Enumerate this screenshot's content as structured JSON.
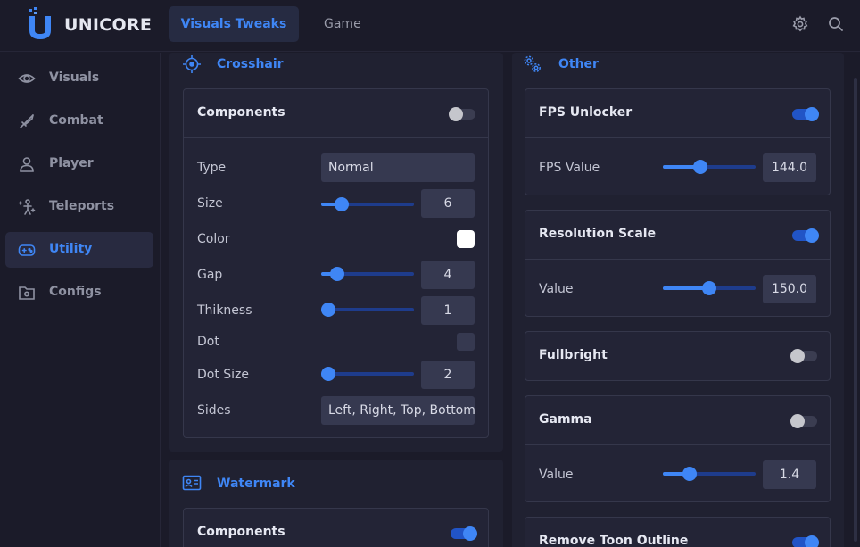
{
  "app": {
    "brand": "UNICORE"
  },
  "tabs": [
    {
      "label": "Visuals Tweaks"
    },
    {
      "label": "Game"
    }
  ],
  "sidebar": {
    "items": [
      {
        "label": "Visuals",
        "icon": "eye-icon"
      },
      {
        "label": "Combat",
        "icon": "sword-icon"
      },
      {
        "label": "Player",
        "icon": "user-icon"
      },
      {
        "label": "Teleports",
        "icon": "teleport-icon"
      },
      {
        "label": "Utility",
        "icon": "gamepad-icon"
      },
      {
        "label": "Configs",
        "icon": "folder-gear-icon"
      }
    ],
    "active": "Utility"
  },
  "crosshair": {
    "title": "Crosshair",
    "card_title": "Components",
    "enabled": false,
    "type": {
      "label": "Type",
      "value": "Normal"
    },
    "size": {
      "label": "Size",
      "value": "6",
      "fraction": 0.22
    },
    "color": {
      "label": "Color",
      "value": "#ffffff"
    },
    "gap": {
      "label": "Gap",
      "value": "4",
      "fraction": 0.17
    },
    "thikness": {
      "label": "Thikness",
      "value": "1",
      "fraction": 0.08
    },
    "dot": {
      "label": "Dot",
      "checked": false
    },
    "dot_size": {
      "label": "Dot Size",
      "value": "2",
      "fraction": 0.08
    },
    "sides": {
      "label": "Sides",
      "value": "Left, Right, Top, Bottom"
    }
  },
  "watermark": {
    "title": "Watermark",
    "card_title": "Components",
    "enabled": true
  },
  "other": {
    "title": "Other",
    "fps_unlocker": {
      "title": "FPS Unlocker",
      "enabled": true,
      "value_label": "FPS Value",
      "value": "144.0",
      "fraction": 0.4
    },
    "resolution_scale": {
      "title": "Resolution Scale",
      "enabled": true,
      "value_label": "Value",
      "value": "150.0",
      "fraction": 0.5
    },
    "fullbright": {
      "title": "Fullbright",
      "enabled": false
    },
    "gamma": {
      "title": "Gamma",
      "enabled": false,
      "value_label": "Value",
      "value": "1.4",
      "fraction": 0.29
    },
    "remove_toon_outline": {
      "title": "Remove Toon Outline",
      "enabled": true
    }
  },
  "colors": {
    "accent": "#3f86f5",
    "background": "#1b1b29",
    "panel": "#202131",
    "card": "#232436"
  }
}
